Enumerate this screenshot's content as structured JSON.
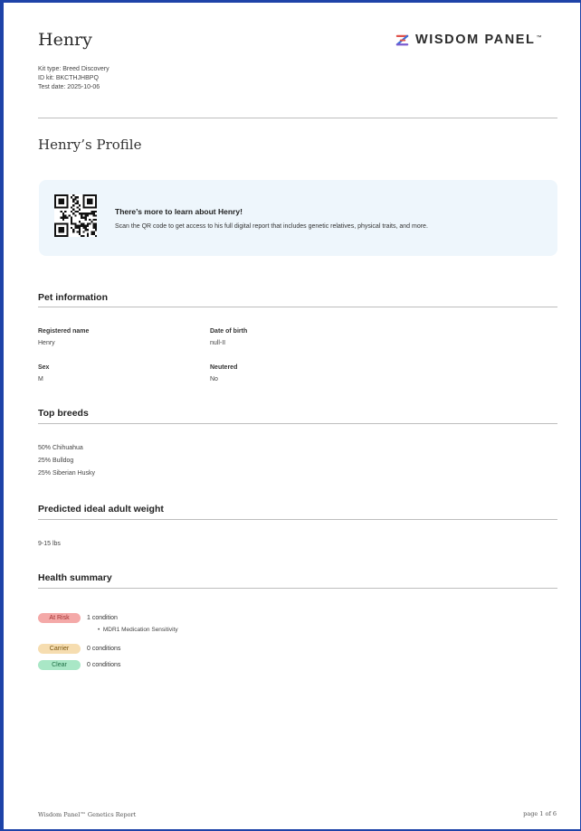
{
  "header": {
    "pet_name": "Henry",
    "logo_text": "WISDOM PANEL",
    "logo_tm": "™",
    "kit_type": "Kit type: Breed Discovery",
    "id_kit": "ID kit: BKCTHJHBPQ",
    "test_date": "Test date: 2025-10-06"
  },
  "profile": {
    "title": "Henry’s Profile"
  },
  "banner": {
    "title": "There’s more to learn about Henry!",
    "text": "Scan the QR code to get access to his full digital report that includes genetic relatives, physical traits, and more."
  },
  "pet_info": {
    "heading": "Pet information",
    "registered_name_label": "Registered name",
    "registered_name": "Henry",
    "dob_label": "Date of birth",
    "dob": "null-II",
    "sex_label": "Sex",
    "sex": "M",
    "neutered_label": "Neutered",
    "neutered": "No"
  },
  "top_breeds": {
    "heading": "Top breeds",
    "items": [
      "50% Chihuahua",
      "25% Bulldog",
      "25% Siberian Husky"
    ]
  },
  "weight": {
    "heading": "Predicted ideal adult weight",
    "value": "9-15 lbs"
  },
  "health": {
    "heading": "Health summary",
    "at_risk_label": "At Risk",
    "at_risk_count": "1 condition",
    "at_risk_condition": "MDR1 Medication Sensitivity",
    "carrier_label": "Carrier",
    "carrier_count": "0 conditions",
    "clear_label": "Clear",
    "clear_count": "0 conditions"
  },
  "footer": {
    "left": "Wisdom Panel™ Genetics Report",
    "right": "page 1 of 6"
  },
  "colors": {
    "border": "#1e43a8",
    "banner_bg": "#eef6fc",
    "at_risk": "#f4a9a8",
    "carrier": "#f6ddb0",
    "clear": "#a9e7c6"
  }
}
